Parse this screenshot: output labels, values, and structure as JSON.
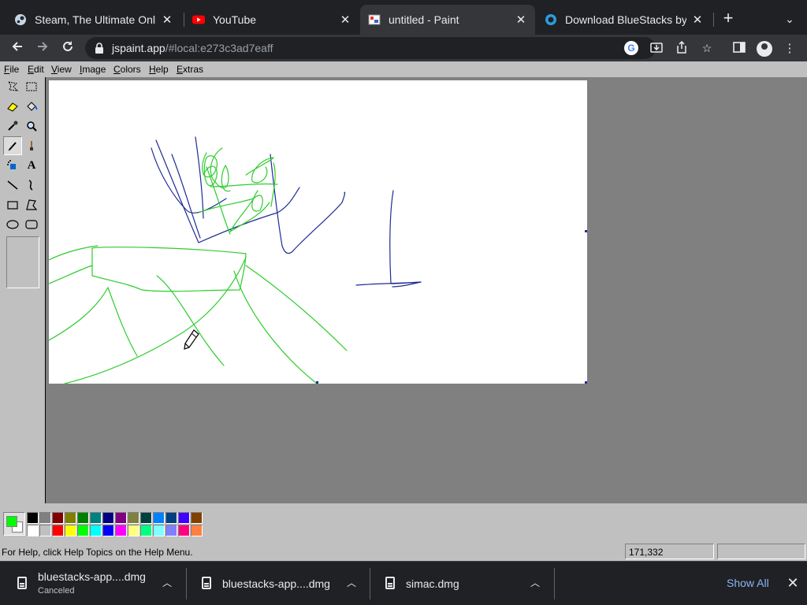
{
  "browser": {
    "tabs": [
      {
        "title": "Steam, The Ultimate Online",
        "favicon": "steam-icon"
      },
      {
        "title": "YouTube",
        "favicon": "youtube-icon"
      },
      {
        "title": "untitled - Paint",
        "favicon": "paint-icon"
      },
      {
        "title": "Download BlueStacks by Blu",
        "favicon": "bluestacks-icon"
      }
    ],
    "url_host": "jspaint.app",
    "url_path": "/#local:e273c3ad7eaff"
  },
  "paint": {
    "menus": [
      "File",
      "Edit",
      "View",
      "Image",
      "Colors",
      "Help",
      "Extras"
    ],
    "tools": [
      "free-form-select",
      "select",
      "eraser",
      "fill-with-color",
      "pick-color",
      "magnifier",
      "pencil",
      "brush",
      "airbrush",
      "text",
      "line",
      "curve",
      "rectangle",
      "polygon",
      "ellipse",
      "rounded-rectangle"
    ],
    "selected_tool": "pencil",
    "current_foreground": "#00ff00",
    "current_background": "#ffffff",
    "palette": [
      "#000000",
      "#808080",
      "#800000",
      "#808000",
      "#008000",
      "#008080",
      "#000080",
      "#800080",
      "#808040",
      "#004040",
      "#0080ff",
      "#004080",
      "#4000ff",
      "#804000",
      "#ffffff",
      "#c0c0c0",
      "#ff0000",
      "#ffff00",
      "#00ff00",
      "#00ffff",
      "#0000ff",
      "#ff00ff",
      "#ffff80",
      "#00ff80",
      "#80ffff",
      "#8080ff",
      "#ff0080",
      "#ff8040"
    ],
    "status_text": "For Help, click Help Topics on the Help Menu.",
    "cursor_position": "171,332",
    "stroke_colors": {
      "blue": "#1f2c93",
      "green": "#2ecc2e"
    }
  },
  "downloads": {
    "items": [
      {
        "name": "bluestacks-app....dmg",
        "status": "Canceled"
      },
      {
        "name": "bluestacks-app....dmg",
        "status": ""
      },
      {
        "name": "simac.dmg",
        "status": ""
      }
    ],
    "show_all": "Show All"
  }
}
